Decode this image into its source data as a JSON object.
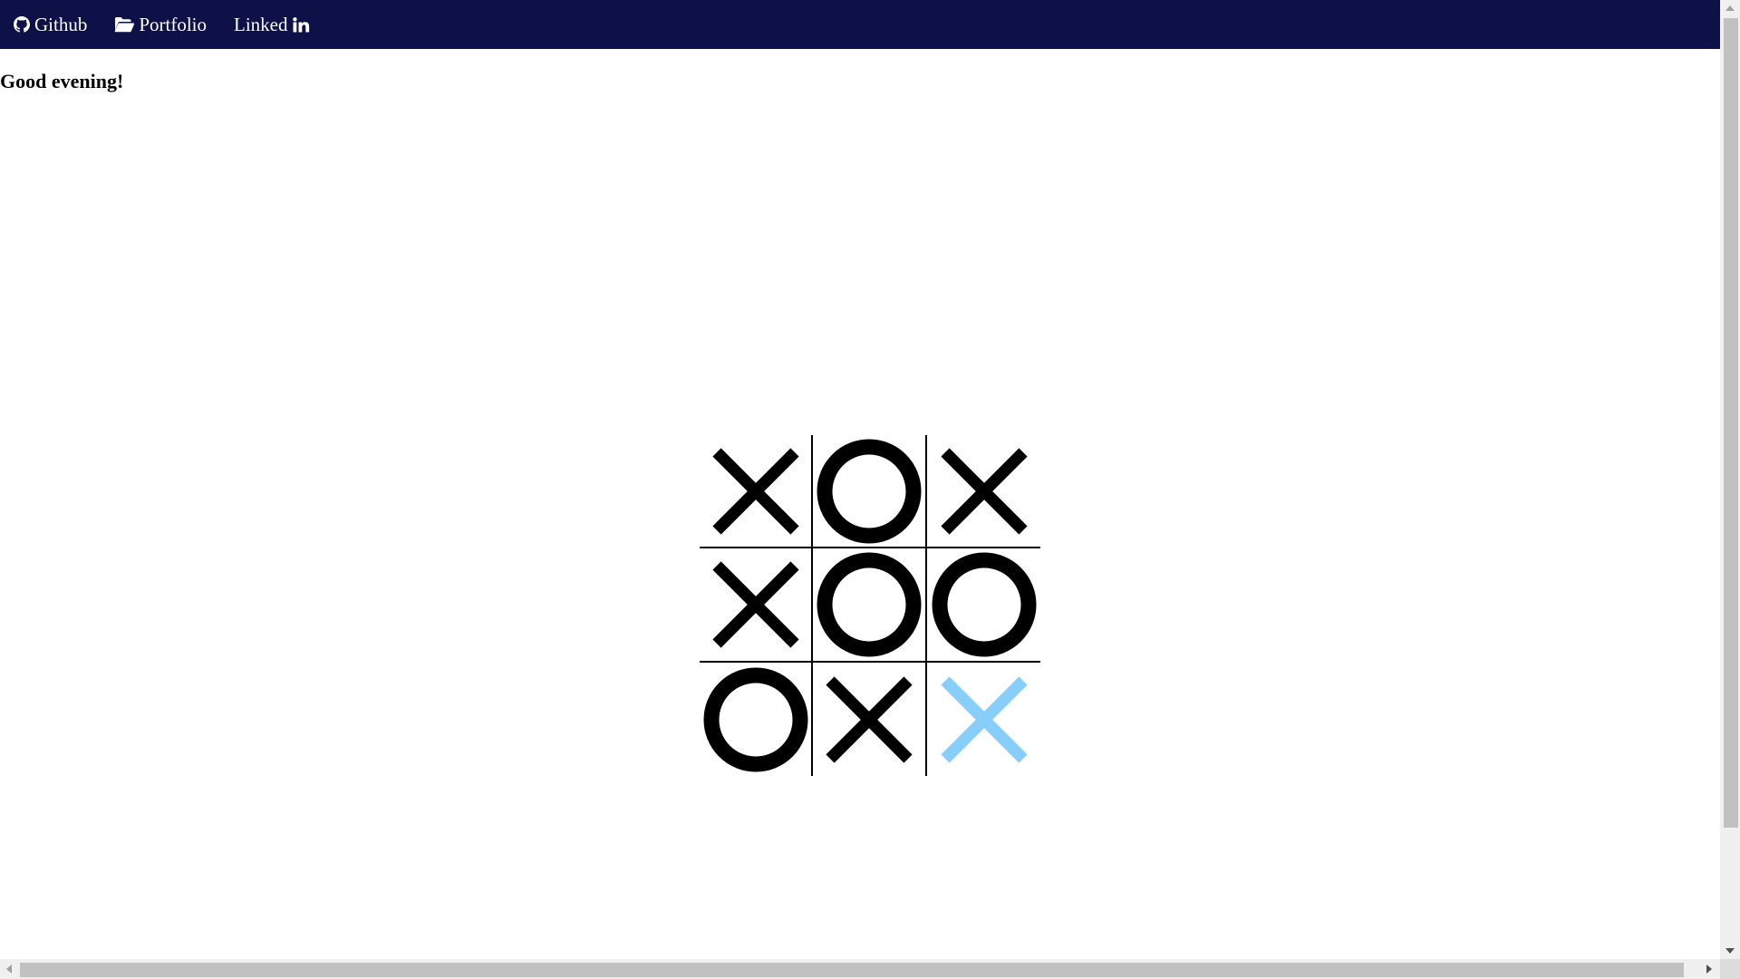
{
  "colors": {
    "navbar_bg": "#0d1147",
    "nav_text": "#ffffff",
    "page_bg": "#ffffff",
    "mark": "#000000",
    "highlight_mark": "#87cefa",
    "grid_line": "#000000"
  },
  "nav": {
    "links": [
      {
        "label": "Github",
        "icon": "github-icon",
        "icon_position": "before"
      },
      {
        "label": "Portfolio",
        "icon": "folder-open-icon",
        "icon_position": "before"
      },
      {
        "label": "Linked",
        "icon": "linkedin-in-icon",
        "icon_position": "after"
      }
    ]
  },
  "greeting": "Good evening!",
  "board": {
    "cells": [
      {
        "mark": "X",
        "highlight": false
      },
      {
        "mark": "O",
        "highlight": false
      },
      {
        "mark": "X",
        "highlight": false
      },
      {
        "mark": "X",
        "highlight": false
      },
      {
        "mark": "O",
        "highlight": false
      },
      {
        "mark": "O",
        "highlight": false
      },
      {
        "mark": "O",
        "highlight": false
      },
      {
        "mark": "X",
        "highlight": false
      },
      {
        "mark": "X",
        "highlight": true
      }
    ]
  },
  "scrollbars": {
    "vertical": true,
    "horizontal": true
  }
}
